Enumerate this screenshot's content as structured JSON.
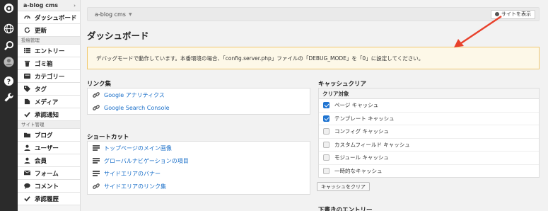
{
  "sidebar": {
    "site_name": "a-blog cms",
    "caret": "›",
    "top_items": [
      {
        "label": "ダッシュボード",
        "icon": "dashboard-icon"
      },
      {
        "label": "更新",
        "icon": "refresh-icon"
      }
    ],
    "sections": [
      {
        "title": "投稿管理",
        "items": [
          {
            "label": "エントリー",
            "icon": "list-icon"
          },
          {
            "label": "ゴミ箱",
            "icon": "trash-icon"
          },
          {
            "label": "カテゴリー",
            "icon": "category-icon"
          },
          {
            "label": "タグ",
            "icon": "tag-icon"
          },
          {
            "label": "メディア",
            "icon": "media-icon"
          },
          {
            "label": "承認通知",
            "icon": "check-icon"
          }
        ]
      },
      {
        "title": "サイト管理",
        "items": [
          {
            "label": "ブログ",
            "icon": "folder-icon"
          },
          {
            "label": "ユーザー",
            "icon": "user-icon"
          },
          {
            "label": "会員",
            "icon": "member-icon"
          },
          {
            "label": "フォーム",
            "icon": "form-icon"
          },
          {
            "label": "コメント",
            "icon": "comment-icon"
          },
          {
            "label": "承認履歴",
            "icon": "approval-history-icon"
          }
        ]
      }
    ]
  },
  "header": {
    "breadcrumb": "a-blog cms",
    "view_site_label": "サイトを表示"
  },
  "page": {
    "title": "ダッシュボード",
    "alert": "デバッグモードで動作しています。本番環境の場合、「config.server.php」ファイルの「DEBUG_MODE」を「0」に設定してください。"
  },
  "links": {
    "title": "リンク集",
    "items": [
      "Google アナリティクス",
      "Google Search Console"
    ]
  },
  "shortcuts": {
    "title": "ショートカット",
    "items": [
      {
        "label": "トップページのメイン画像",
        "icon": "module-icon"
      },
      {
        "label": "グローバルナビゲーションの項目",
        "icon": "module-icon"
      },
      {
        "label": "サイドエリアのバナー",
        "icon": "module-icon"
      },
      {
        "label": "サイドエリアのリンク集",
        "icon": "link-icon"
      }
    ]
  },
  "cache": {
    "title": "キャッシュクリア",
    "header": "クリア対象",
    "items": [
      {
        "label": "ページ キャッシュ",
        "checked": true
      },
      {
        "label": "テンプレート キャッシュ",
        "checked": true
      },
      {
        "label": "コンフィグ キャッシュ",
        "checked": false
      },
      {
        "label": "カスタムフィールド キャッシュ",
        "checked": false
      },
      {
        "label": "モジュール キャッシュ",
        "checked": false
      },
      {
        "label": "一時的なキャッシュ",
        "checked": false
      }
    ],
    "button": "キャッシュをクリア"
  },
  "next_section_title": "下書きのエントリー",
  "colors": {
    "rail": "#2b2b2b",
    "link": "#1a6fc9",
    "alert_border": "#f0c870",
    "alert_bg": "#fdf8e8",
    "checkbox_on": "#1f74d1",
    "arrow": "#e8412c"
  }
}
